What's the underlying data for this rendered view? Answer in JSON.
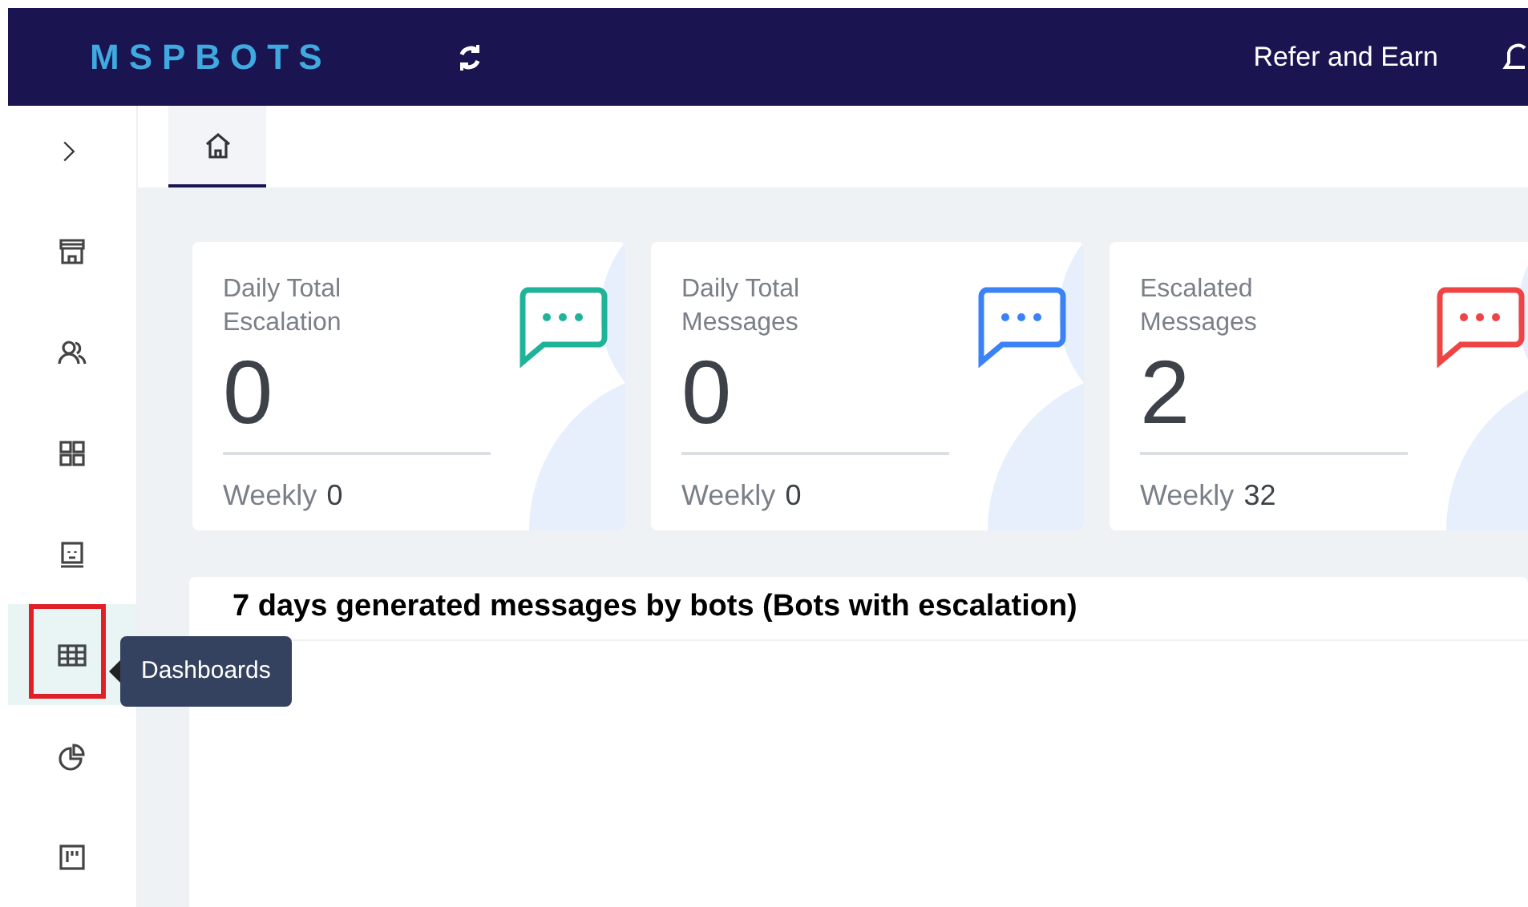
{
  "header": {
    "logo": "MSPBOTS",
    "link": "Refer and Earn"
  },
  "sidebar": {
    "items": [
      {
        "selected": false
      },
      {
        "selected": false
      },
      {
        "selected": false
      },
      {
        "selected": false
      },
      {
        "selected": true
      },
      {
        "selected": false
      },
      {
        "selected": false
      }
    ],
    "tooltip": "Dashboards"
  },
  "tabs": [
    {
      "selected": true
    }
  ],
  "cards": [
    {
      "title": "Daily Total Escalation",
      "value": "0",
      "weekly_label": "Weekly",
      "weekly_value": "0",
      "color": "#1fb39a"
    },
    {
      "title": "Daily Total Messages",
      "value": "0",
      "weekly_label": "Weekly",
      "weekly_value": "0",
      "color": "#3b82f6"
    },
    {
      "title": "Escalated Messages",
      "value": "2",
      "weekly_label": "Weekly",
      "weekly_value": "32",
      "color": "#ef4444"
    }
  ],
  "chart_panel": {
    "title": "7 days generated messages by bots (Bots with escalation)"
  }
}
